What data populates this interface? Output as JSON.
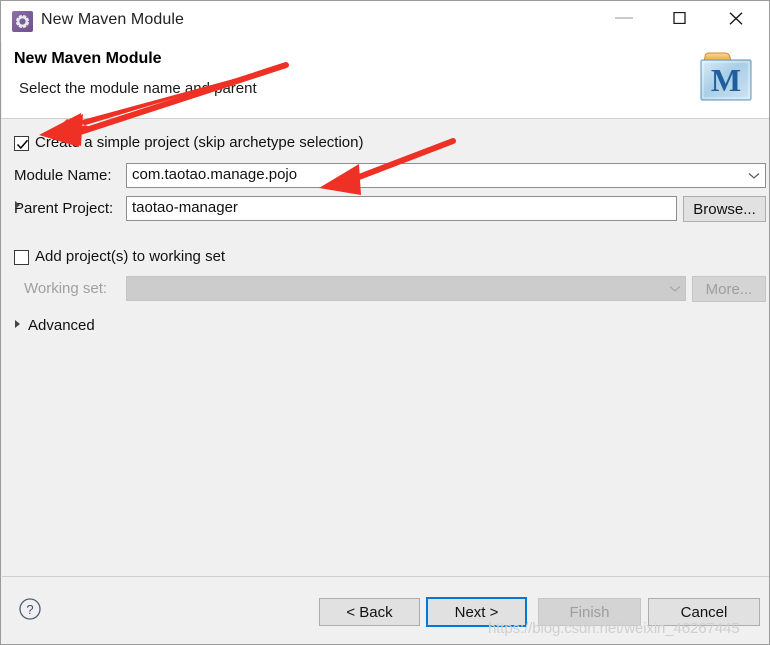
{
  "window": {
    "title": "New Maven Module",
    "icon": "maven-module-gear-icon",
    "minimize_label": "—",
    "maximize_label": "□",
    "close_label": "✕"
  },
  "header": {
    "title": "New Maven Module",
    "subtitle": "Select the module name and parent",
    "logo": "maven-folder-m-logo"
  },
  "form": {
    "simple_project": {
      "label": "Create a simple project (skip archetype selection)",
      "checked": true
    },
    "module_name": {
      "label": "Module Name:",
      "value": "com.taotao.manage.pojo",
      "placeholder": ""
    },
    "parent_project": {
      "label": "Parent Project:",
      "value": "taotao-manager",
      "placeholder": "",
      "browse_label": "Browse..."
    },
    "working_set_toggle": {
      "label": "Add project(s) to working set",
      "checked": false
    },
    "working_set": {
      "label": "Working set:",
      "value": "",
      "more_label": "More...",
      "enabled": false
    },
    "advanced": {
      "label": "Advanced",
      "expanded": false
    }
  },
  "footer": {
    "help_label": "?",
    "back_label": "< Back",
    "next_label": "Next >",
    "finish_label": "Finish",
    "cancel_label": "Cancel",
    "finish_enabled": false,
    "default_button": "Next >"
  },
  "watermark": {
    "text": "https://blog.csdn.net/weixin_46267445"
  },
  "annotations": {
    "arrow_color": "#ee3124",
    "arrow_1_target": "Create a simple project checkbox",
    "arrow_2_target": "Module Name field value"
  },
  "colors": {
    "accent": "#0078d7",
    "dialog_bg": "#f0f0f0",
    "header_bg": "#ffffff",
    "arrow_red": "#ee3124"
  }
}
